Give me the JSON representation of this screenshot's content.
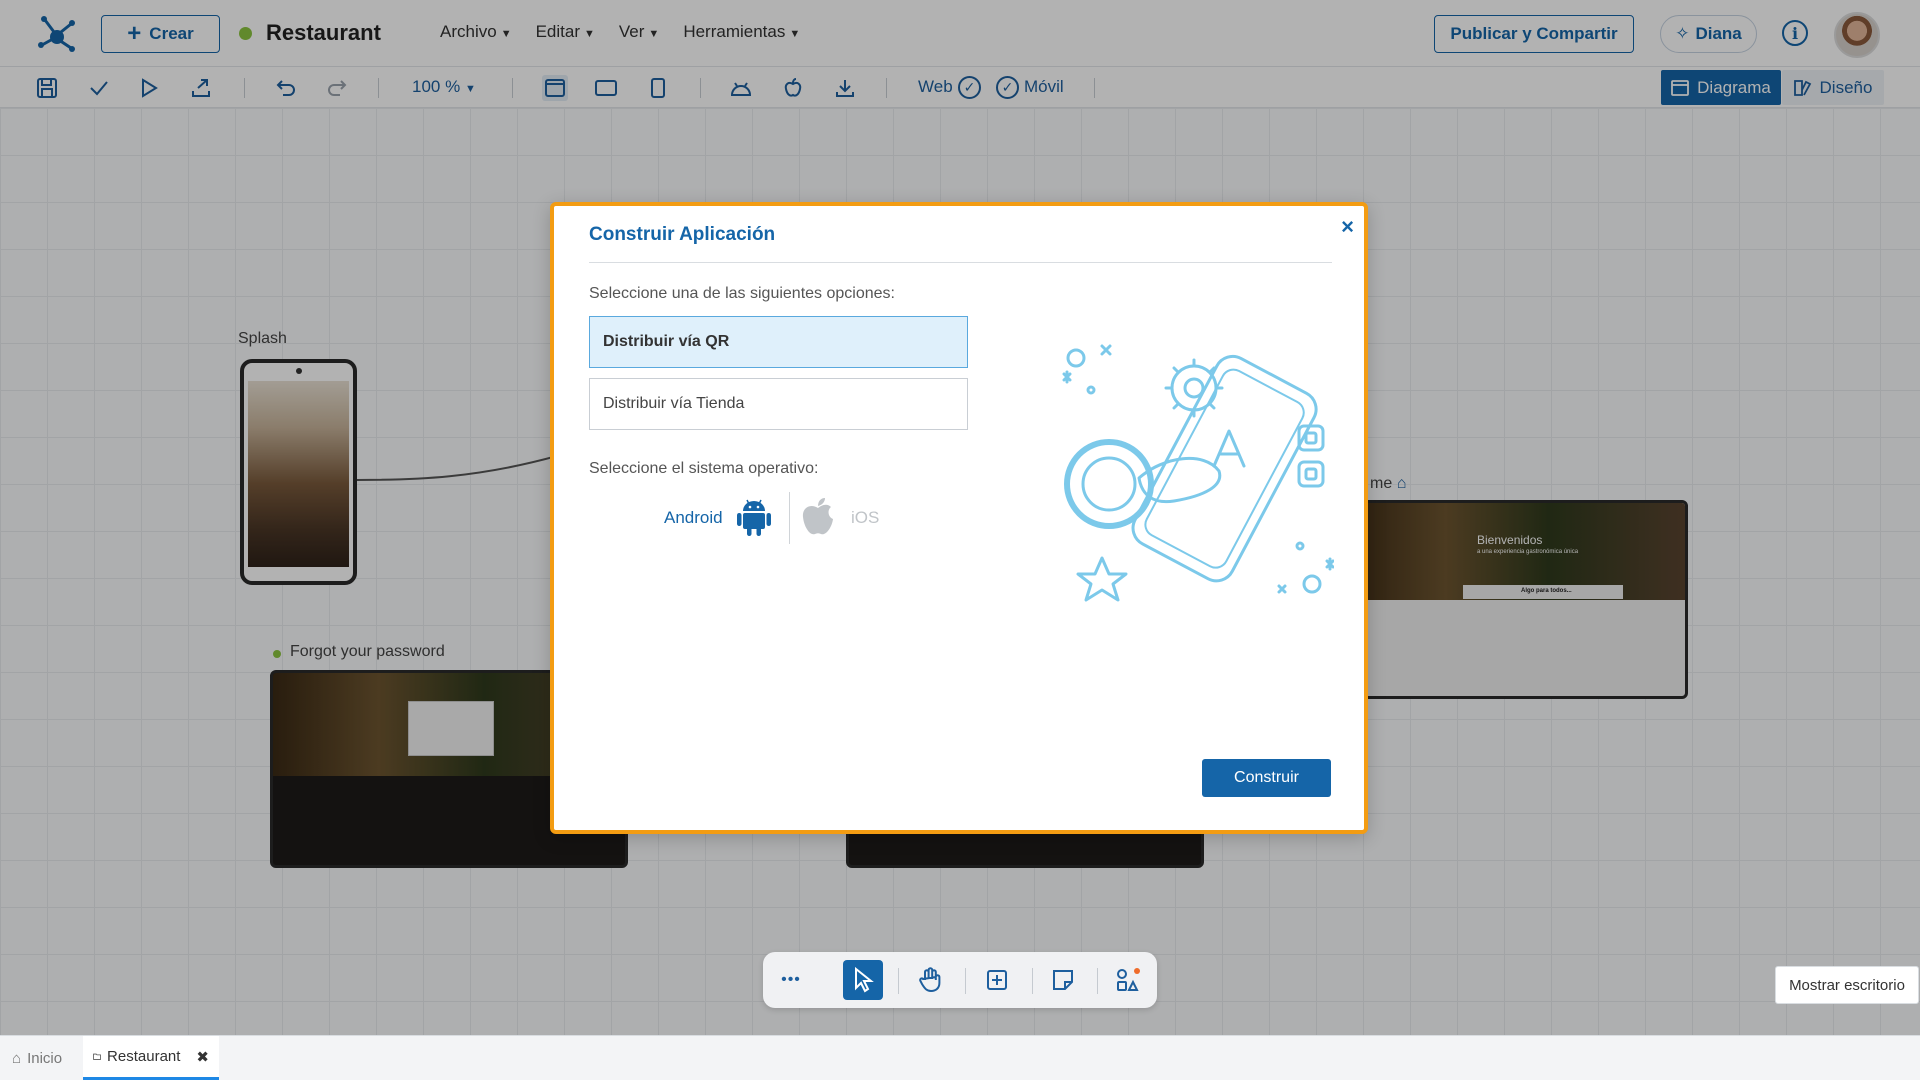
{
  "header": {
    "create_label": "Crear",
    "project_name": "Restaurant",
    "menu": [
      "Archivo",
      "Editar",
      "Ver",
      "Herramientas"
    ],
    "publish_label": "Publicar y Compartir",
    "assistant_label": "Diana"
  },
  "toolbar": {
    "zoom": "100 %",
    "web_label": "Web",
    "mobile_label": "Móvil",
    "diagram_label": "Diagrama",
    "design_label": "Diseño"
  },
  "canvas": {
    "nodes": {
      "splash": "Splash",
      "forgot_password": "Forgot your password",
      "home_partial": "me",
      "home_welcome": "Bienvenidos",
      "home_tagline": "a una experiencia gastronómica única",
      "home_section": "Algo para todos..."
    }
  },
  "dialog": {
    "title": "Construir Aplicación",
    "close": "×",
    "options_prompt": "Seleccione una de las siguientes opciones:",
    "options": [
      {
        "label": "Distribuir vía QR",
        "selected": true
      },
      {
        "label": "Distribuir vía Tienda",
        "selected": false
      }
    ],
    "os_prompt": "Seleccione el sistema operativo:",
    "os": {
      "android": "Android",
      "ios": "iOS",
      "selected": "Android"
    },
    "build_label": "Construir"
  },
  "floating_toolbar": {
    "more": "•••",
    "active_tool": "pointer"
  },
  "tooltip": "Mostrar escritorio",
  "tabs": [
    {
      "label": "Inicio",
      "active": false
    },
    {
      "label": "Restaurant",
      "active": true
    }
  ],
  "colors": {
    "primary": "#1565a8",
    "dialog_border": "#f39c12",
    "status_dot": "#8cc540",
    "selected_option_bg": "#dff0fb"
  }
}
